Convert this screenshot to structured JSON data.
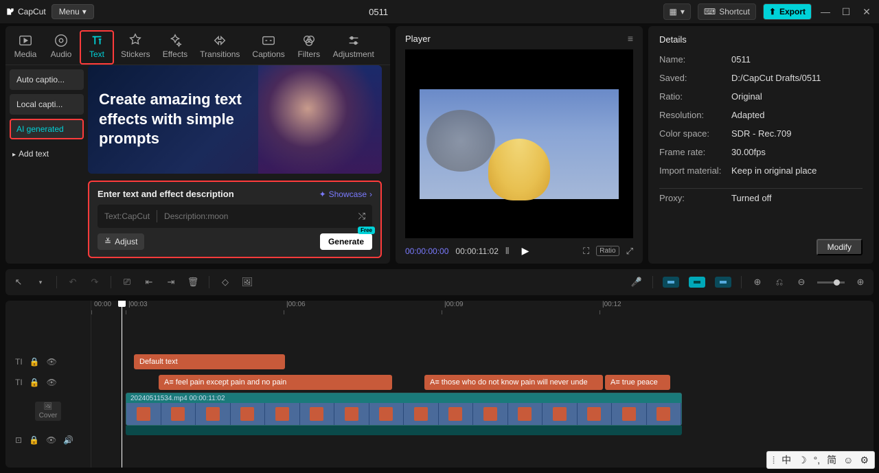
{
  "app": {
    "name": "CapCut",
    "menu_label": "Menu",
    "title": "0511"
  },
  "titlebar_right": {
    "shortcut": "Shortcut",
    "export": "Export"
  },
  "top_tabs": [
    {
      "id": "media",
      "label": "Media"
    },
    {
      "id": "audio",
      "label": "Audio"
    },
    {
      "id": "text",
      "label": "Text"
    },
    {
      "id": "stickers",
      "label": "Stickers"
    },
    {
      "id": "effects",
      "label": "Effects"
    },
    {
      "id": "transitions",
      "label": "Transitions"
    },
    {
      "id": "captions",
      "label": "Captions"
    },
    {
      "id": "filters",
      "label": "Filters"
    },
    {
      "id": "adjustment",
      "label": "Adjustment"
    }
  ],
  "text_sidebar": {
    "auto_captions": "Auto captio...",
    "local_captions": "Local capti...",
    "ai_generated": "AI generated",
    "add_text": "Add text"
  },
  "hero": {
    "headline": "Create amazing text effects with simple prompts"
  },
  "prompt": {
    "title": "Enter text and effect description",
    "showcase": "Showcase",
    "text_placeholder": "Text:CapCut",
    "desc_placeholder": "Description:moon",
    "adjust": "Adjust",
    "generate": "Generate",
    "free_badge": "Free"
  },
  "player": {
    "title": "Player",
    "time_current": "00:00:00:00",
    "time_total": "00:00:11:02",
    "ratio_label": "Ratio"
  },
  "details": {
    "title": "Details",
    "rows": {
      "name_label": "Name:",
      "name_value": "0511",
      "saved_label": "Saved:",
      "saved_value": "D:/CapCut Drafts/0511",
      "ratio_label": "Ratio:",
      "ratio_value": "Original",
      "resolution_label": "Resolution:",
      "resolution_value": "Adapted",
      "colorspace_label": "Color space:",
      "colorspace_value": "SDR - Rec.709",
      "framerate_label": "Frame rate:",
      "framerate_value": "30.00fps",
      "import_label": "Import material:",
      "import_value": "Keep in original place",
      "proxy_label": "Proxy:",
      "proxy_value": "Turned off"
    },
    "modify": "Modify"
  },
  "timeline": {
    "ruler": [
      "00:00",
      "|00:03",
      "|00:06",
      "|00:09",
      "|00:12"
    ],
    "cover_label": "Cover",
    "clips": {
      "default_text": "Default text",
      "text_a": "A≡ feel pain except pain and no pain",
      "text_b": "A≡ those who do not know pain will never unde",
      "text_c": "A≡ true peace",
      "video_name": "20240511534.mp4  00:00:11:02"
    }
  },
  "ime": {
    "lang": "中",
    "mode": "简"
  }
}
